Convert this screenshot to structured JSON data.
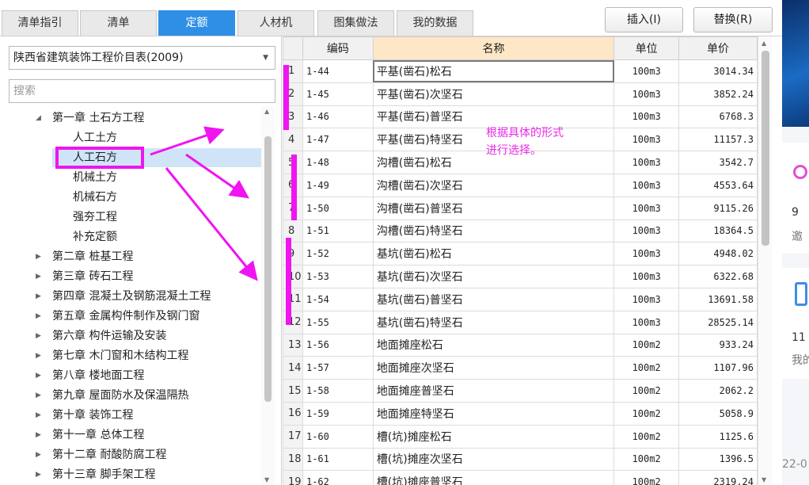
{
  "tabs": [
    {
      "label": "清单指引",
      "active": false
    },
    {
      "label": "清单",
      "active": false
    },
    {
      "label": "定额",
      "active": true
    },
    {
      "label": "人材机",
      "active": false
    },
    {
      "label": "图集做法",
      "active": false
    },
    {
      "label": "我的数据",
      "active": false
    }
  ],
  "actions": {
    "insert": "插入(I)",
    "replace": "替换(R)"
  },
  "library": {
    "selected": "陕西省建筑装饰工程价目表(2009)"
  },
  "search": {
    "placeholder": "搜索"
  },
  "tree": [
    {
      "label": "第一章 土石方工程",
      "level": 0,
      "expanded": true
    },
    {
      "label": "人工土方",
      "level": 1
    },
    {
      "label": "人工石方",
      "level": 1,
      "selected": true
    },
    {
      "label": "机械土方",
      "level": 1
    },
    {
      "label": "机械石方",
      "level": 1
    },
    {
      "label": "强夯工程",
      "level": 1
    },
    {
      "label": "补充定额",
      "level": 1
    },
    {
      "label": "第二章 桩基工程",
      "level": 0
    },
    {
      "label": "第三章 砖石工程",
      "level": 0
    },
    {
      "label": "第四章 混凝土及钢筋混凝土工程",
      "level": 0
    },
    {
      "label": "第五章 金属构件制作及钢门窗",
      "level": 0
    },
    {
      "label": "第六章 构件运输及安装",
      "level": 0
    },
    {
      "label": "第七章 木门窗和木结构工程",
      "level": 0
    },
    {
      "label": "第八章 楼地面工程",
      "level": 0
    },
    {
      "label": "第九章 屋面防水及保温隔热",
      "level": 0
    },
    {
      "label": "第十章 装饰工程",
      "level": 0
    },
    {
      "label": "第十一章 总体工程",
      "level": 0
    },
    {
      "label": "第十二章 耐酸防腐工程",
      "level": 0
    },
    {
      "label": "第十三章 脚手架工程",
      "level": 0
    }
  ],
  "grid": {
    "headers": {
      "code": "编码",
      "name": "名称",
      "unit": "单位",
      "price": "单价"
    },
    "rows": [
      {
        "no": "1",
        "code": "1-44",
        "name": "平基(凿石)松石",
        "unit": "100m3",
        "price": "3014.34"
      },
      {
        "no": "2",
        "code": "1-45",
        "name": "平基(凿石)次坚石",
        "unit": "100m3",
        "price": "3852.24"
      },
      {
        "no": "3",
        "code": "1-46",
        "name": "平基(凿石)普坚石",
        "unit": "100m3",
        "price": "6768.3"
      },
      {
        "no": "4",
        "code": "1-47",
        "name": "平基(凿石)特坚石",
        "unit": "100m3",
        "price": "11157.3"
      },
      {
        "no": "5",
        "code": "1-48",
        "name": "沟槽(凿石)松石",
        "unit": "100m3",
        "price": "3542.7"
      },
      {
        "no": "6",
        "code": "1-49",
        "name": "沟槽(凿石)次坚石",
        "unit": "100m3",
        "price": "4553.64"
      },
      {
        "no": "7",
        "code": "1-50",
        "name": "沟槽(凿石)普坚石",
        "unit": "100m3",
        "price": "9115.26"
      },
      {
        "no": "8",
        "code": "1-51",
        "name": "沟槽(凿石)特坚石",
        "unit": "100m3",
        "price": "18364.5"
      },
      {
        "no": "9",
        "code": "1-52",
        "name": "基坑(凿石)松石",
        "unit": "100m3",
        "price": "4948.02"
      },
      {
        "no": "10",
        "code": "1-53",
        "name": "基坑(凿石)次坚石",
        "unit": "100m3",
        "price": "6322.68"
      },
      {
        "no": "11",
        "code": "1-54",
        "name": "基坑(凿石)普坚石",
        "unit": "100m3",
        "price": "13691.58"
      },
      {
        "no": "12",
        "code": "1-55",
        "name": "基坑(凿石)特坚石",
        "unit": "100m3",
        "price": "28525.14"
      },
      {
        "no": "13",
        "code": "1-56",
        "name": "地面摊座松石",
        "unit": "100m2",
        "price": "933.24"
      },
      {
        "no": "14",
        "code": "1-57",
        "name": "地面摊座次坚石",
        "unit": "100m2",
        "price": "1107.96"
      },
      {
        "no": "15",
        "code": "1-58",
        "name": "地面摊座普坚石",
        "unit": "100m2",
        "price": "2062.2"
      },
      {
        "no": "16",
        "code": "1-59",
        "name": "地面摊座特坚石",
        "unit": "100m2",
        "price": "5058.9"
      },
      {
        "no": "17",
        "code": "1-60",
        "name": "槽(坑)摊座松石",
        "unit": "100m2",
        "price": "1125.6"
      },
      {
        "no": "18",
        "code": "1-61",
        "name": "槽(坑)摊座次坚石",
        "unit": "100m2",
        "price": "1396.5"
      },
      {
        "no": "19",
        "code": "1-62",
        "name": "槽(坑)摊座普坚石",
        "unit": "100m2",
        "price": "2319.24"
      }
    ]
  },
  "annotation": {
    "note_line1": "根据具体的形式",
    "note_line2": "进行选择。",
    "color": "#f014f0"
  },
  "side_panel": {
    "text_1": "9",
    "text_2": "邀",
    "text_3": "11",
    "text_4": "我的",
    "text_5": "22-0"
  }
}
